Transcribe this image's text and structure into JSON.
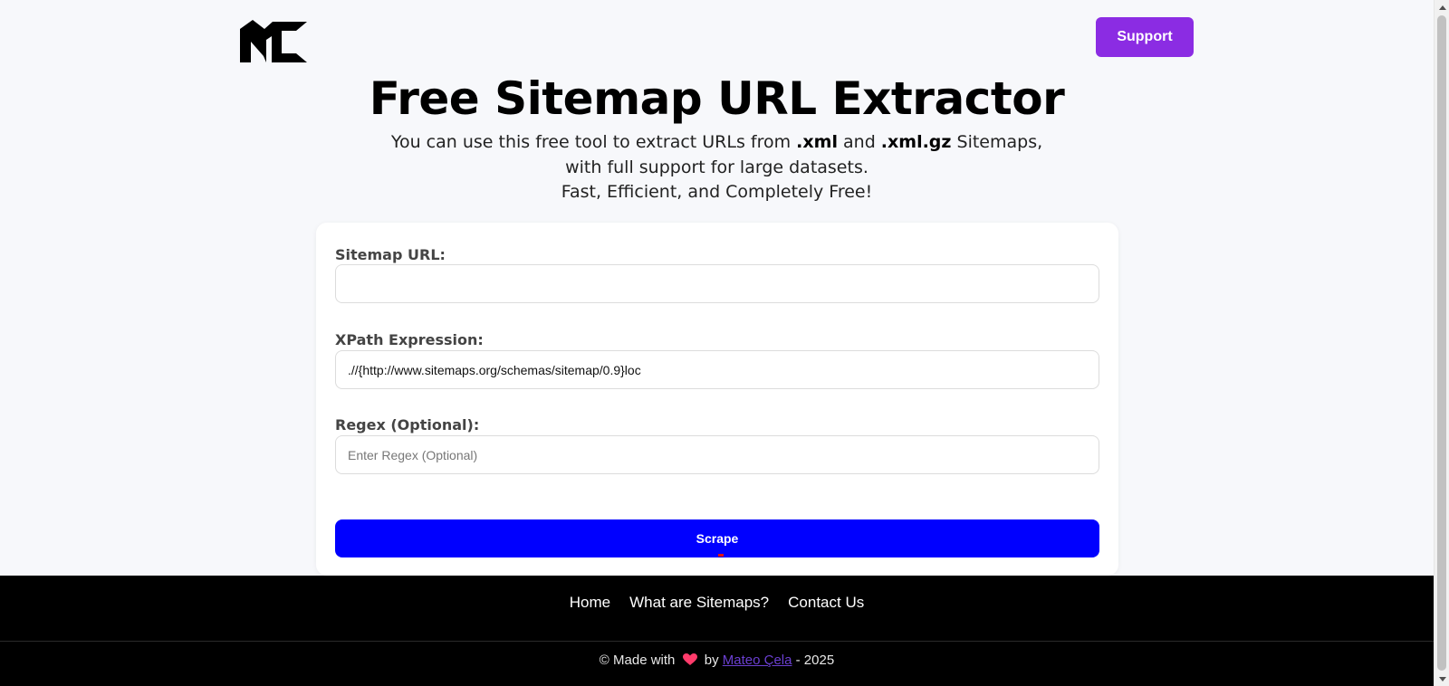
{
  "header": {
    "logo_text": "MC",
    "support_label": "Support"
  },
  "hero": {
    "title": "Free Sitemap URL Extractor",
    "subtitle_prefix": "You can use this free tool to extract URLs from ",
    "subtitle_xml": ".xml",
    "subtitle_and": " and ",
    "subtitle_xmlgz": ".xml.gz",
    "subtitle_suffix": " Sitemaps,",
    "subtitle_line2": "with full support for large datasets.",
    "subtitle_line3": "Fast, Efficient, and Completely Free!"
  },
  "form": {
    "sitemap_url": {
      "label": "Sitemap URL:",
      "value": "",
      "placeholder": ""
    },
    "xpath": {
      "label": "XPath Expression:",
      "value": ".//{http://www.sitemaps.org/schemas/sitemap/0.9}loc"
    },
    "regex": {
      "label": "Regex (Optional):",
      "value": "",
      "placeholder": "Enter Regex (Optional)"
    },
    "scrape_label": "Scrape"
  },
  "footer": {
    "nav": [
      "Home",
      "What are Sitemaps?",
      "Contact Us"
    ],
    "credit_prefix": "© Made with",
    "credit_by": "by",
    "author": "Mateo Çela",
    "credit_suffix": "- 2025"
  },
  "icons": {
    "logo": "mc-logo-icon",
    "heart": "heart-icon",
    "scroll_up": "chevron-up-icon",
    "scroll_down": "chevron-down-icon"
  },
  "colors": {
    "support": "#8b2ce3",
    "scrape": "#0000ff",
    "footer_bg": "#000000",
    "heart": "#ff3b6b",
    "author_link": "#6a3fd0"
  }
}
